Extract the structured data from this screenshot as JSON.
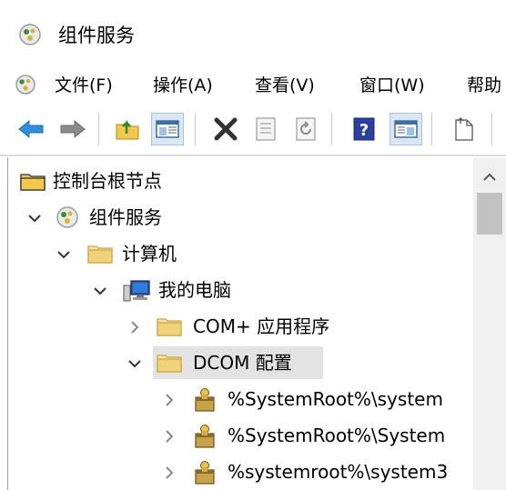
{
  "window": {
    "title": "组件服务"
  },
  "menu": {
    "items": [
      {
        "label": "文件(F)"
      },
      {
        "label": "操作(A)"
      },
      {
        "label": "查看(V)"
      },
      {
        "label": "窗口(W)"
      },
      {
        "label": "帮助"
      }
    ]
  },
  "toolbar": {
    "buttons": [
      {
        "icon": "back-arrow-icon"
      },
      {
        "icon": "forward-arrow-icon"
      },
      {
        "icon": "up-folder-icon"
      },
      {
        "icon": "show-hide-console-tree-icon"
      },
      {
        "icon": "delete-icon"
      },
      {
        "icon": "properties-icon"
      },
      {
        "icon": "refresh-icon"
      },
      {
        "icon": "help-icon"
      },
      {
        "icon": "show-hide-action-pane-icon"
      },
      {
        "icon": "export-list-icon"
      }
    ]
  },
  "tree": {
    "root": "控制台根节点",
    "component_services": "组件服务",
    "computers": "计算机",
    "my_computer": "我的电脑",
    "com_plus": "COM+ 应用程序",
    "dcom_config": "DCOM 配置",
    "dcom_items": [
      {
        "label": "%SystemRoot%\\system"
      },
      {
        "label": "%SystemRoot%\\System"
      },
      {
        "label": "%systemroot%\\system3"
      }
    ]
  },
  "colors": {
    "folder": "#f2c94c",
    "arrow_blue": "#2f8fd8",
    "selected_bg": "#e0e0e0"
  }
}
